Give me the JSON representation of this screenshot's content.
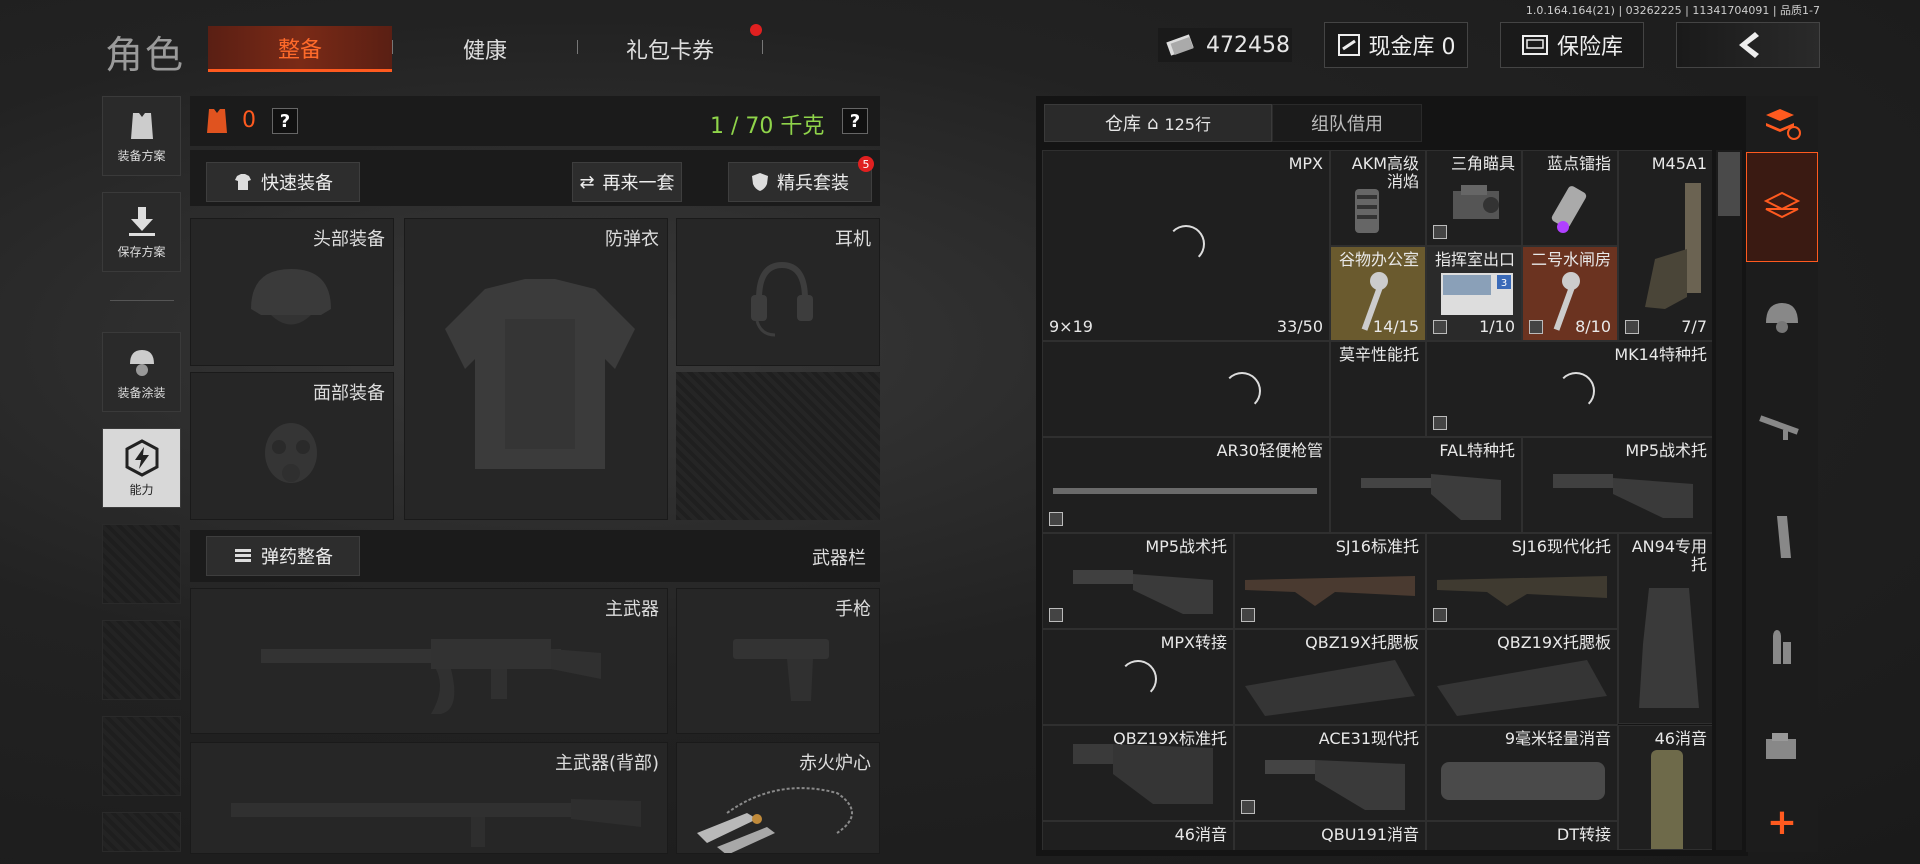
{
  "version": "1.0.164.164(21) | 03262225 | 11341704091 | 品质1-7",
  "header": {
    "title": "角色",
    "tabs": [
      {
        "label": "整备",
        "active": true
      },
      {
        "label": "健康",
        "active": false
      },
      {
        "label": "礼包卡券",
        "active": false
      }
    ],
    "currency": "472458",
    "cash_vault": "现金库 0",
    "safe_vault": "保险库"
  },
  "left_sidebar": {
    "items": [
      {
        "label": "装备方案",
        "icon": "vest-icon"
      },
      {
        "label": "保存方案",
        "icon": "download-icon"
      },
      {
        "label": "装备涂装",
        "icon": "helmet-paint-icon"
      },
      {
        "label": "能力",
        "icon": "hex-bolt-icon"
      }
    ]
  },
  "loadout": {
    "armor_count": "0",
    "weight": "1 / 70 千克",
    "quick_equip": "快速装备",
    "again": "再来一套",
    "elite_set": "精兵套装",
    "elite_badge": "5",
    "slots": {
      "head": "头部装备",
      "body": "防弹衣",
      "headset": "耳机",
      "face": "面部装备"
    },
    "ammo_button": "弹药整备",
    "weapon_bar": "武器栏",
    "weapon_slots": {
      "primary": "主武器",
      "pistol": "手枪",
      "primary_back": "主武器(背部)",
      "melee": "赤火炉心"
    }
  },
  "warehouse": {
    "tab_storage": "仓库",
    "rows": "125行",
    "tab_team": "组队借用",
    "items": [
      {
        "name": "MPX",
        "sub": "9×19",
        "count": "33/50"
      },
      {
        "name": "AKM高级消焰",
        "count": ""
      },
      {
        "name": "三角瞄具",
        "count": ""
      },
      {
        "name": "蓝点镭指",
        "count": ""
      },
      {
        "name": "M45A1",
        "count": "7/7"
      },
      {
        "name": "谷物办公室",
        "count": "14/15"
      },
      {
        "name": "指挥室出口",
        "count": "1/10"
      },
      {
        "name": "二号水闸房",
        "count": "8/10"
      },
      {
        "name": "莫辛性能托",
        "count": ""
      },
      {
        "name": "MK14特种托",
        "count": ""
      },
      {
        "name": "AR30轻便枪管",
        "count": ""
      },
      {
        "name": "FAL特种托",
        "count": ""
      },
      {
        "name": "MP5战术托",
        "count": ""
      },
      {
        "name": "MP5战术托",
        "count": ""
      },
      {
        "name": "SJ16标准托",
        "count": ""
      },
      {
        "name": "SJ16现代化托",
        "count": ""
      },
      {
        "name": "AN94专用托",
        "count": ""
      },
      {
        "name": "MPX转接",
        "count": ""
      },
      {
        "name": "QBZ19X托腮板",
        "count": ""
      },
      {
        "name": "QBZ19X托腮板",
        "count": ""
      },
      {
        "name": "QBZ19X标准托",
        "count": ""
      },
      {
        "name": "ACE31现代托",
        "count": ""
      },
      {
        "name": "9毫米轻量消音",
        "count": ""
      },
      {
        "name": "46消音",
        "count": ""
      },
      {
        "name": "46消音",
        "count": ""
      },
      {
        "name": "QBU191消音",
        "count": ""
      },
      {
        "name": "DT转接",
        "count": ""
      }
    ]
  },
  "right_filters": [
    "stack-refresh-icon",
    "layers-icon",
    "helmet-icon",
    "rifle-icon",
    "magazine-icon",
    "ammo-icon",
    "sight-icon",
    "plus-icon"
  ]
}
